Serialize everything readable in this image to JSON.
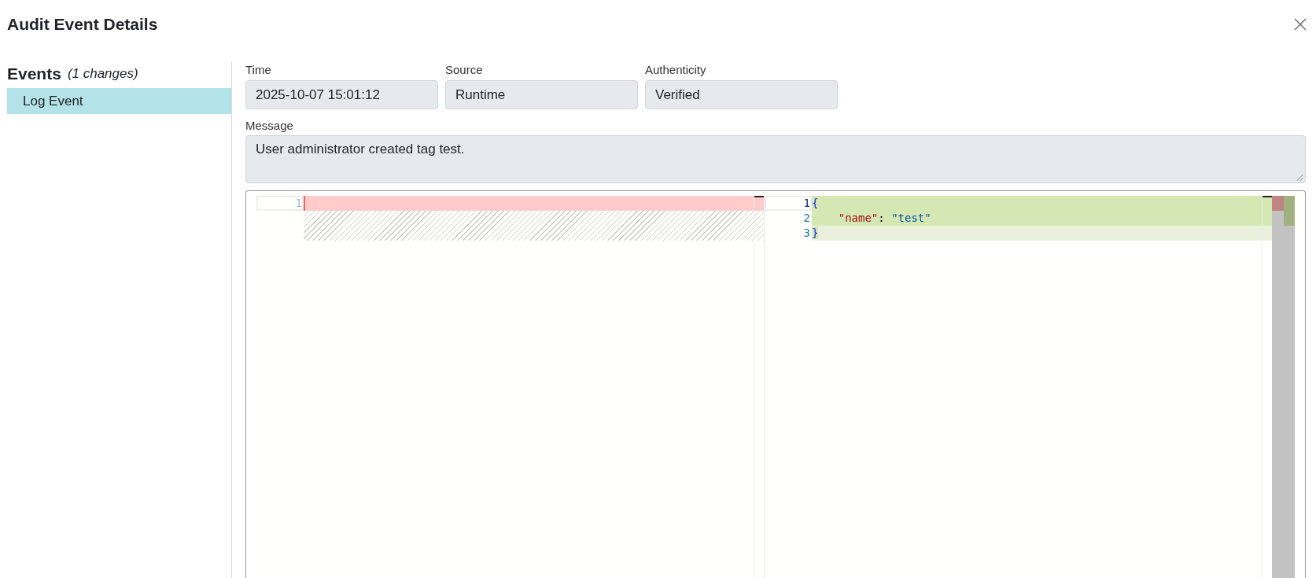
{
  "dialog": {
    "title": "Audit Event Details"
  },
  "events": {
    "heading": "Events",
    "count": "(1 changes)",
    "items": [
      {
        "label": "Log Event",
        "selected": true
      }
    ]
  },
  "fields": [
    {
      "label": "Time",
      "value": "2025-10-07 15:01:12",
      "disabled": true
    },
    {
      "label": "Source",
      "value": "Runtime",
      "disabled": true
    },
    {
      "label": "Authenticity",
      "value": "Verified",
      "disabled": true
    }
  ],
  "message": {
    "label": "Message",
    "value": "User administrator created tag test.",
    "disabled": true
  },
  "diff": {
    "panes": [
      {
        "kind": "original",
        "lines": [
          {
            "number": "1",
            "kind": "removed",
            "newline_changed": true,
            "current": true
          }
        ]
      },
      {
        "kind": "modified",
        "lines": [
          {
            "number": "1",
            "kind": "added",
            "newline_changed": true,
            "current": true,
            "tokens": [
              {
                "text": "{",
                "kind": "bracket"
              }
            ]
          },
          {
            "number": "2",
            "kind": "added",
            "newline_changed": true,
            "current": false,
            "tokens": [
              {
                "text": "    \"name\"",
                "kind": "key"
              },
              {
                "text": ": ",
                "kind": "punctuation"
              },
              {
                "text": "\"test\"",
                "kind": "string"
              }
            ]
          },
          {
            "number": "3",
            "kind": "added",
            "newline_changed": false,
            "current": false,
            "tokens": [
              {
                "text": "}",
                "kind": "bracket"
              }
            ]
          }
        ]
      }
    ]
  }
}
